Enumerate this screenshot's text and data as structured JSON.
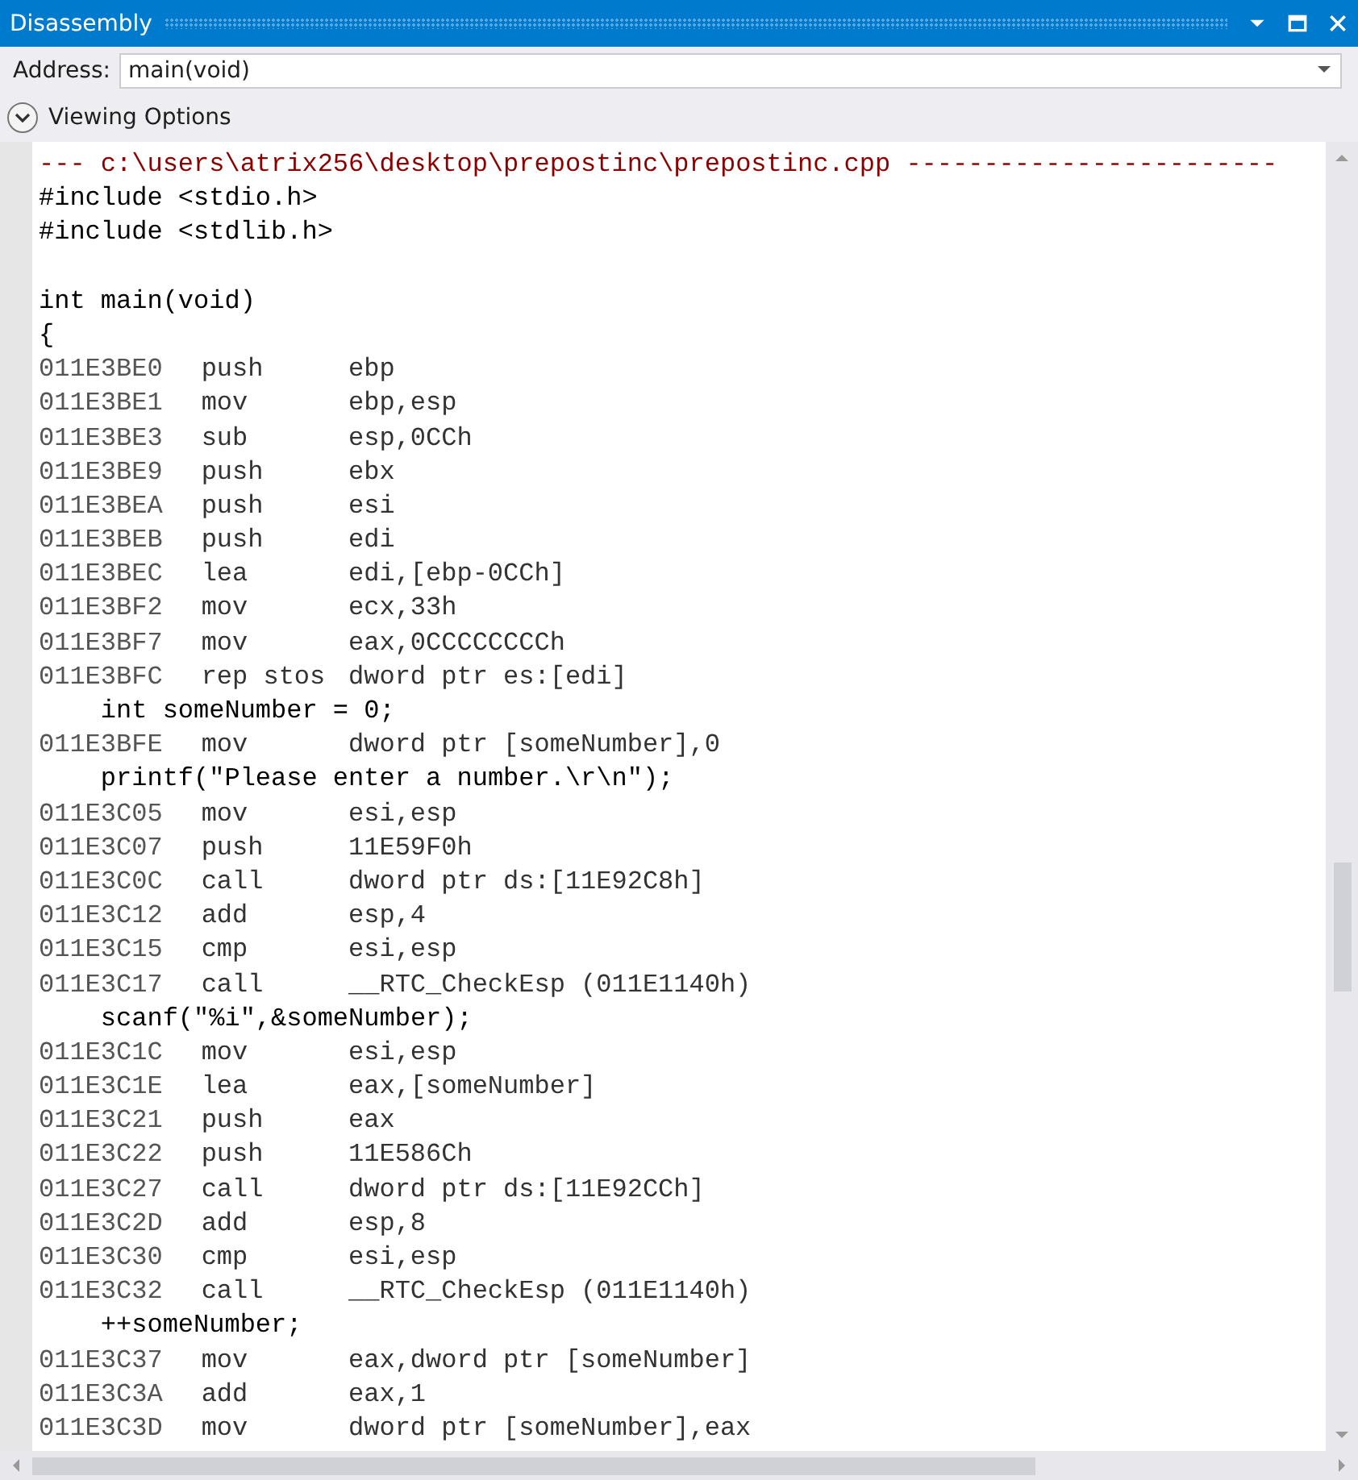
{
  "window": {
    "title": "Disassembly"
  },
  "address_bar": {
    "label": "Address:",
    "value": "main(void)"
  },
  "viewing_options": {
    "label": "Viewing Options",
    "expanded": false
  },
  "lines": [
    {
      "kind": "header",
      "text": "--- c:\\users\\atrix256\\desktop\\prepostinc\\prepostinc.cpp ------------------------"
    },
    {
      "kind": "source",
      "text": "#include <stdio.h>"
    },
    {
      "kind": "source",
      "text": "#include <stdlib.h>"
    },
    {
      "kind": "blank"
    },
    {
      "kind": "source",
      "text": "int main(void)"
    },
    {
      "kind": "source",
      "text": "{"
    },
    {
      "kind": "asm",
      "address": "011E3BE0",
      "mnemonic": "push",
      "operand": "ebp"
    },
    {
      "kind": "asm",
      "address": "011E3BE1",
      "mnemonic": "mov",
      "operand": "ebp,esp"
    },
    {
      "kind": "asm",
      "address": "011E3BE3",
      "mnemonic": "sub",
      "operand": "esp,0CCh"
    },
    {
      "kind": "asm",
      "address": "011E3BE9",
      "mnemonic": "push",
      "operand": "ebx"
    },
    {
      "kind": "asm",
      "address": "011E3BEA",
      "mnemonic": "push",
      "operand": "esi"
    },
    {
      "kind": "asm",
      "address": "011E3BEB",
      "mnemonic": "push",
      "operand": "edi"
    },
    {
      "kind": "asm",
      "address": "011E3BEC",
      "mnemonic": "lea",
      "operand": "edi,[ebp-0CCh]"
    },
    {
      "kind": "asm",
      "address": "011E3BF2",
      "mnemonic": "mov",
      "operand": "ecx,33h"
    },
    {
      "kind": "asm",
      "address": "011E3BF7",
      "mnemonic": "mov",
      "operand": "eax,0CCCCCCCCh"
    },
    {
      "kind": "asm",
      "address": "011E3BFC",
      "mnemonic": "rep stos",
      "operand": "dword ptr es:[edi]"
    },
    {
      "kind": "source",
      "text": "    int someNumber = 0;"
    },
    {
      "kind": "asm",
      "address": "011E3BFE",
      "mnemonic": "mov",
      "operand": "dword ptr [someNumber],0"
    },
    {
      "kind": "source",
      "text": "    printf(\"Please enter a number.\\r\\n\");"
    },
    {
      "kind": "asm",
      "address": "011E3C05",
      "mnemonic": "mov",
      "operand": "esi,esp"
    },
    {
      "kind": "asm",
      "address": "011E3C07",
      "mnemonic": "push",
      "operand": "11E59F0h"
    },
    {
      "kind": "asm",
      "address": "011E3C0C",
      "mnemonic": "call",
      "operand": "dword ptr ds:[11E92C8h]"
    },
    {
      "kind": "asm",
      "address": "011E3C12",
      "mnemonic": "add",
      "operand": "esp,4"
    },
    {
      "kind": "asm",
      "address": "011E3C15",
      "mnemonic": "cmp",
      "operand": "esi,esp"
    },
    {
      "kind": "asm",
      "address": "011E3C17",
      "mnemonic": "call",
      "operand": "__RTC_CheckEsp (011E1140h)"
    },
    {
      "kind": "source",
      "text": "    scanf(\"%i\",&someNumber);"
    },
    {
      "kind": "asm",
      "address": "011E3C1C",
      "mnemonic": "mov",
      "operand": "esi,esp"
    },
    {
      "kind": "asm",
      "address": "011E3C1E",
      "mnemonic": "lea",
      "operand": "eax,[someNumber]"
    },
    {
      "kind": "asm",
      "address": "011E3C21",
      "mnemonic": "push",
      "operand": "eax"
    },
    {
      "kind": "asm",
      "address": "011E3C22",
      "mnemonic": "push",
      "operand": "11E586Ch"
    },
    {
      "kind": "asm",
      "address": "011E3C27",
      "mnemonic": "call",
      "operand": "dword ptr ds:[11E92CCh]"
    },
    {
      "kind": "asm",
      "address": "011E3C2D",
      "mnemonic": "add",
      "operand": "esp,8"
    },
    {
      "kind": "asm",
      "address": "011E3C30",
      "mnemonic": "cmp",
      "operand": "esi,esp"
    },
    {
      "kind": "asm",
      "address": "011E3C32",
      "mnemonic": "call",
      "operand": "__RTC_CheckEsp (011E1140h)"
    },
    {
      "kind": "source",
      "text": "    ++someNumber;"
    },
    {
      "kind": "asm",
      "address": "011E3C37",
      "mnemonic": "mov",
      "operand": "eax,dword ptr [someNumber]"
    },
    {
      "kind": "asm",
      "address": "011E3C3A",
      "mnemonic": "add",
      "operand": "eax,1"
    },
    {
      "kind": "asm",
      "address": "011E3C3D",
      "mnemonic": "mov",
      "operand": "dword ptr [someNumber],eax"
    }
  ]
}
